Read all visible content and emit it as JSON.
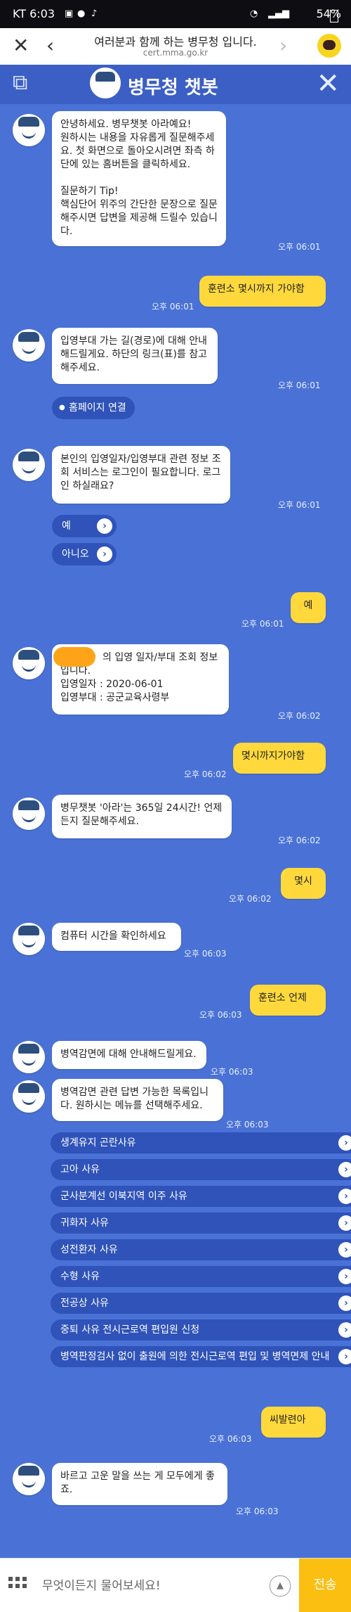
{
  "status_bar": {
    "carrier_time": "KT 6:03",
    "battery": "54%"
  },
  "browser": {
    "title": "여러분과 함께 하는 병무청 입니다.",
    "url": "cert.mma.go.kr"
  },
  "header": {
    "title": "병무청 챗봇"
  },
  "chat": {
    "m1": {
      "text": "안녕하세요. 병무챗봇 아라예요!\n원하시는 내용을 자유롭게 질문해주세요. 첫 화면으로 돌아오시려면 좌측 하단에 있는 홈버튼을 클릭하세요.\n\n질문하기 Tip!\n핵심단어 위주의 간단한 문장으로 질문해주시면 답변을 제공해 드릴수 있습니다.",
      "time": "오후 06:01"
    },
    "u1": {
      "text": "훈련소 몇시까지 가야함",
      "time": "오후 06:01"
    },
    "m2": {
      "text": "입영부대 가는 길(경로)에 대해 안내해드릴게요. 하단의 링크(표)를 참고해주세요.",
      "time": "오후 06:01",
      "link": "홈페이지 연결"
    },
    "m3": {
      "text": "본인의 입영일자/입영부대 관련 정보 조회 서비스는 로그인이 필요합니다. 로그인 하실래요?",
      "time": "오후 06:01",
      "yes": "예",
      "no": "아니오"
    },
    "u2": {
      "text": "예",
      "time": "오후 06:01"
    },
    "m4": {
      "text": "의 입영 일자/부대 조회 정보입니다.\n입영일자 : 2020-06-01\n입영부대 : 공군교육사령부",
      "time": "오후 06:02"
    },
    "u3": {
      "text": "몇시까지가야함",
      "time": "오후 06:02"
    },
    "m5": {
      "text": "병무챗봇 '아라'는 365일 24시간! 언제든지 질문해주세요.",
      "time": "오후 06:02"
    },
    "u4": {
      "text": "몇시",
      "time": "오후 06:02"
    },
    "m6": {
      "text": "컴퓨터 시간을 확인하세요",
      "time": "오후 06:03"
    },
    "u5": {
      "text": "훈련소 언제",
      "time": "오후 06:03"
    },
    "m7": {
      "text": "병역감면에 대해 안내해드릴게요.",
      "time": "오후 06:03"
    },
    "m8": {
      "text": "병역감면 관련 답변 가능한 목록입니다. 원하시는 메뉴를 선택해주세요.",
      "time": "오후 06:03"
    },
    "menu": [
      "생계유지 곤란사유",
      "고아 사유",
      "군사분계선 이북지역 이주 사유",
      "귀화자 사유",
      "성전환자 사유",
      "수형 사유",
      "전공상 사유",
      "중퇴 사유 전시근로역 편입원 신청",
      "병역판정검사 없이 출원에 의한 전시근로역 편입 및 병역면제 안내"
    ],
    "u6": {
      "text": "씨발련아",
      "time": "오후 06:03"
    },
    "m9": {
      "text": "바르고 고운 말을 쓰는 게 모두에게 좋죠.",
      "time": "오후 06:03"
    }
  },
  "input": {
    "placeholder": "무엇이든지 물어보세요!",
    "send": "전송"
  },
  "colors": {
    "background": "#4a72d6",
    "user_bubble": "#ffd93b",
    "button": "#2f53b9",
    "send": "#fbbf12"
  }
}
